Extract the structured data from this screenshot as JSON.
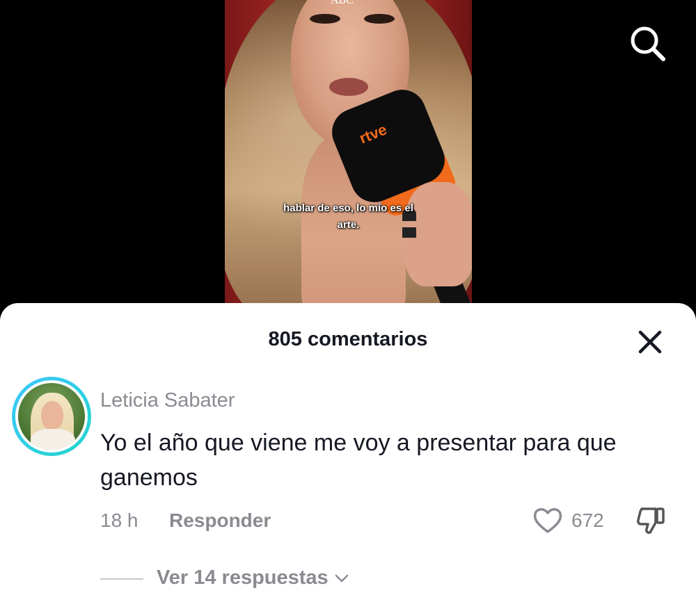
{
  "video": {
    "watermark": "ABC",
    "mic_logo": "rtve",
    "subtitle_line1": "hablar de eso, lo mío es el",
    "subtitle_line2": "arte."
  },
  "header": {
    "search_icon": "search-icon"
  },
  "comments_sheet": {
    "title": "805 comentarios",
    "close_icon": "close-icon",
    "comment": {
      "username": "Leticia Sabater",
      "text": "Yo el año que viene me voy a presentar para que ganemos",
      "time": "18 h",
      "reply_label": "Responder",
      "like_count": "672",
      "like_icon": "heart-icon",
      "dislike_icon": "thumbs-down-icon",
      "view_replies_label": "Ver 14 respuestas"
    }
  },
  "colors": {
    "avatar_ring": "#3ec6ff",
    "secondary_text": "#8a8b91",
    "primary_text": "#161823",
    "mic_accent": "#f26a1b"
  }
}
